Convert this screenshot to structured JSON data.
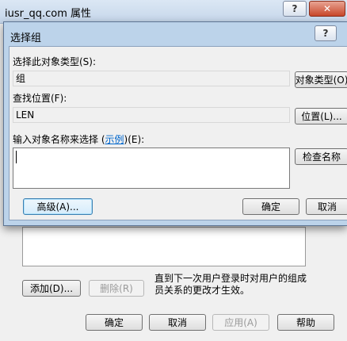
{
  "background_window": {
    "title": "iusr_qq.com 属性",
    "help_icon": "?",
    "close_icon": "✕",
    "note_text": "直到下一次用户登录时对用户的组成员关系的更改才生效。",
    "buttons": {
      "add": "添加(D)...",
      "remove": "删除(R)"
    },
    "footer_buttons": {
      "ok": "确定",
      "cancel": "取消",
      "apply": "应用(A)",
      "help": "帮助"
    }
  },
  "dialog": {
    "title": "选择组",
    "help_icon": "?",
    "object_type": {
      "label": "选择此对象类型(S):",
      "value": "组",
      "button": "对象类型(O)"
    },
    "location": {
      "label": "查找位置(F):",
      "value": "LEN",
      "button": "位置(L)..."
    },
    "object_name": {
      "label_prefix": "输入对象名称来选择 (",
      "link": "示例",
      "label_suffix": ")(E):",
      "value": "",
      "check_button": "检查名称"
    },
    "advanced_button": "高级(A)...",
    "ok_button": "确定",
    "cancel_button": "取消"
  }
}
